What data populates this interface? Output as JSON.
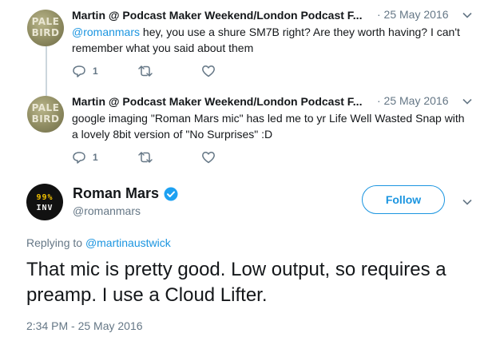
{
  "replies": [
    {
      "avatar": {
        "line1": "PALE",
        "line2": "BIRD"
      },
      "author": "Martin @ Podcast Maker Weekend/London Podcast F...",
      "date": "· 25 May 2016",
      "mention": "@romanmars",
      "text": " hey, you use a shure SM7B right? Are they worth having? I can't remember what you said about them",
      "reply_count": "1"
    },
    {
      "avatar": {
        "line1": "PALE",
        "line2": "BIRD"
      },
      "author": "Martin @ Podcast Maker Weekend/London Podcast F...",
      "date": "· 25 May 2016",
      "mention": "",
      "text": "google imaging \"Roman Mars mic\" has led me to yr Life Well Wasted Snap with a lovely 8bit version of \"No Surprises\" :D",
      "reply_count": "1"
    }
  ],
  "main_tweet": {
    "avatar": {
      "line1": "99%",
      "line2": "INV"
    },
    "name": "Roman Mars",
    "handle": "@romanmars",
    "follow_label": "Follow",
    "replying_prefix": "Replying to ",
    "replying_to": "@martinaustwick",
    "text": "That mic is pretty good. Low output, so requires a preamp. I use a Cloud Lifter.",
    "timestamp": "2:34 PM - 25 May 2016"
  },
  "colors": {
    "accent": "#1b95e0",
    "muted": "#657786",
    "text": "#14171a",
    "thread_line": "#ccd6dd"
  },
  "icons": [
    "reply-icon",
    "retweet-icon",
    "like-icon",
    "chevron-down-icon",
    "verified-badge-icon"
  ]
}
